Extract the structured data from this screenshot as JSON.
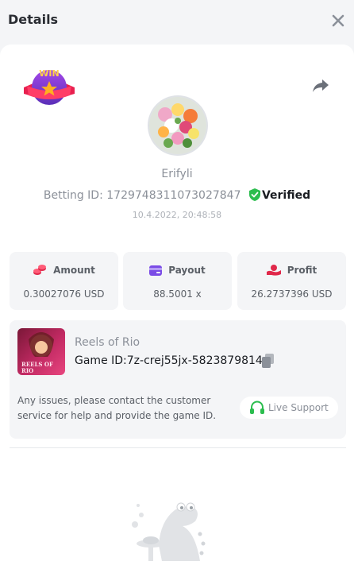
{
  "header": {
    "title": "Details"
  },
  "bet": {
    "username": "Erifyli",
    "betting_id_label": "Betting ID:",
    "betting_id": "1729748311073027847",
    "verified_label": "Verified",
    "timestamp": "10.4.2022, 20:48:58"
  },
  "stats": [
    {
      "label": "Amount",
      "value": "0.30027076 USD",
      "icon": "coins-icon"
    },
    {
      "label": "Payout",
      "value": "88.5001 x",
      "icon": "card-icon"
    },
    {
      "label": "Profit",
      "value": "26.2737396 USD",
      "icon": "hand-coin-icon"
    }
  ],
  "game": {
    "name": "Reels of Rio",
    "id_label": "Game ID:",
    "id": "7z-crej55jx-5823879814",
    "thumb_text": "REELS OF RIO"
  },
  "support": {
    "message": "Any issues, please contact the customer service for help and provide the game ID.",
    "button_label": "Live Support"
  },
  "badge_text": "WIN",
  "colors": {
    "accent_green": "#2bbd4e",
    "accent_red": "#e0284a",
    "accent_purple": "#7b4ce6"
  }
}
